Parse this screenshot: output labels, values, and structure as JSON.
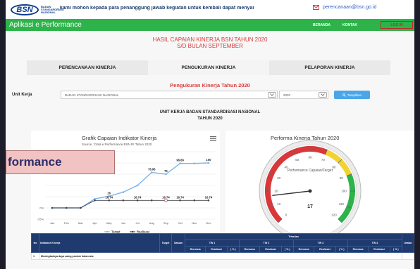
{
  "header": {
    "logo_text": "BSN",
    "logo_caption": "BADAN STANDARDISASI NASIONAL",
    "ticker": ", kami mohon kepada para penanggung jawab kegiatan untuk kembali dapat menyai",
    "email": "perencanaan@bsn.go.id"
  },
  "nav": {
    "brand": "Aplikasi e Performance",
    "beranda": "BERANDA",
    "kontak": "KONTAK",
    "logout": "LOG IN"
  },
  "page": {
    "title_line1": "HASIL CAPAIAN KINERJA BSN TAHUN 2020",
    "title_line2": "S/D BULAN SEPTEMBER",
    "tabs": [
      "PERENCANAAN KINERJA",
      "PENGUKURAN KINERJA",
      "PELAPORAN KINERJA"
    ],
    "section_title": "Pengukuran Kinerja Tahun 2020",
    "unit_label": "Unit Kerja",
    "unit_value": "BADAN STANDARDISASI NASIONAL",
    "year_value": "2020",
    "tampilkan": "Tampilkan",
    "unit_heading_1": "UNIT KERJA BADAN STANDARDISASI NASIONAL",
    "unit_heading_2": "TAHUN 2020"
  },
  "overlay_text": "formance",
  "line_chart": {
    "title": "Grafik Capaian Indikator Kinerja",
    "subtitle": "Source : Data e Performance BSN RI Tahun 2020",
    "menu_icon": "hamburger-menu-icon",
    "credit": "Highcharts.com",
    "legend": [
      "Target",
      "Realisasi"
    ],
    "yticks": [
      "125%",
      "0%",
      "-25%"
    ]
  },
  "chart_data": [
    {
      "type": "line",
      "title": "Grafik Capaian Indikator Kinerja",
      "categories": [
        "Jan",
        "Feb",
        "Mar",
        "Apr",
        "May",
        "Jun",
        "Jul",
        "Aug",
        "Sep",
        "Oct",
        "Nov",
        "Dec"
      ],
      "series": [
        {
          "name": "Target",
          "values": [
            0,
            0,
            0,
            20,
            26,
            35,
            50,
            78.95,
            75,
            98.88,
            98.88,
            100
          ],
          "color": "#7cb5ec"
        },
        {
          "name": "Realisasi",
          "values": [
            0,
            0,
            0,
            16.74,
            16.74,
            16.74,
            16.74,
            16.74,
            16.74,
            16.74,
            16.74,
            16.74
          ],
          "color": "#434348"
        }
      ],
      "data_labels": [
        "26",
        "78.95",
        "75",
        "98.88",
        "100",
        "16.74",
        "16.74",
        "16.74",
        "16.74",
        "16.74"
      ],
      "ylim": [
        -25,
        125
      ]
    },
    {
      "type": "gauge",
      "title": "Performa Kinerja Tahun 2020",
      "label": "Performance Capaian/Target",
      "value": 17,
      "ticks": [
        "0",
        "10",
        "20",
        "30",
        "40",
        "50",
        "60",
        "70",
        "80",
        "90",
        "100",
        "110",
        "120"
      ],
      "range": [
        0,
        120
      ],
      "credit": "Highcharts.com",
      "bands": [
        {
          "from": 90,
          "to": 120,
          "color": "#2db34a"
        },
        {
          "from": 70,
          "to": 90,
          "color": "#f2d230"
        },
        {
          "from": 0,
          "to": 70,
          "color": "#d8383a"
        }
      ]
    }
  ],
  "table": {
    "triwulan": "Triwulan",
    "headers": [
      "No",
      "Indikator Kinerja",
      "Target",
      "Satuan",
      "TW 1",
      "TW 2",
      "TW 3",
      "TW 4",
      "Uraian"
    ],
    "subheaders": [
      "Rencana",
      "Realisasi",
      "( % )"
    ],
    "first_row": [
      "1",
      "Meningkatnya daya saing produk Indonesia"
    ]
  }
}
